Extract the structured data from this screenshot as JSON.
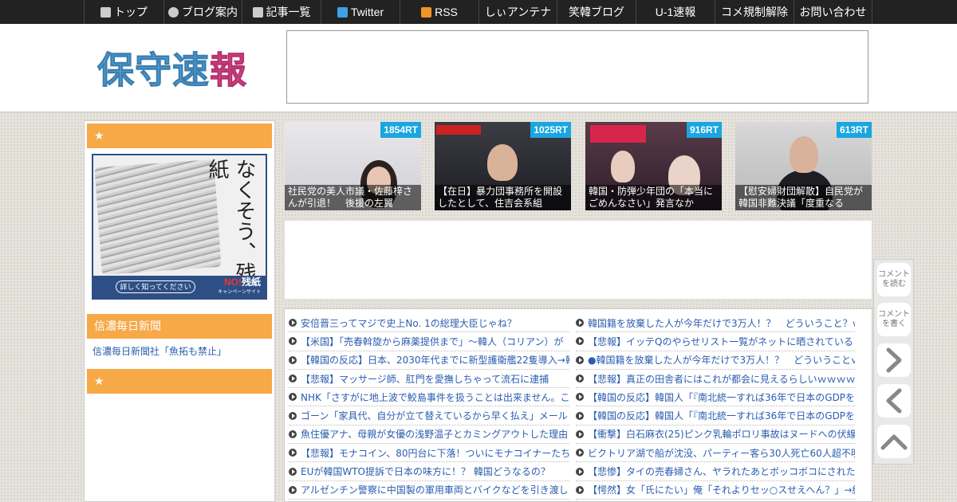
{
  "nav": {
    "items": [
      {
        "label": "トップ",
        "icon": "home-icon"
      },
      {
        "label": "ブログ案内",
        "icon": "info-icon"
      },
      {
        "label": "記事一覧",
        "icon": "list-icon"
      },
      {
        "label": "Twitter",
        "icon": "twitter-icon"
      },
      {
        "label": "RSS",
        "icon": "rss-icon"
      },
      {
        "label": "しぃアンテナ",
        "icon": ""
      },
      {
        "label": "笑韓ブログ",
        "icon": ""
      },
      {
        "label": "U-1速報",
        "icon": ""
      },
      {
        "label": "コメ規制解除",
        "icon": ""
      },
      {
        "label": "お問い合わせ",
        "icon": ""
      }
    ]
  },
  "header": {
    "logo_main": "保守速",
    "logo_accent": "報"
  },
  "sidebar": {
    "head1": "★",
    "banner": {
      "vertical_text": "なくそう、残紙",
      "more_label": "詳しく知ってください",
      "badge_no": "NO!",
      "badge_word": "残紙",
      "badge_sub": "キャンペーンサイト"
    },
    "head2": "信濃毎日新聞",
    "link": "信濃毎日新聞社「魚拓も禁止」",
    "head3": "★"
  },
  "featured": [
    {
      "rt": "1854RT",
      "caption": "社民党の美人市議・佐藤梓さんが引退！　後援の左翼"
    },
    {
      "rt": "1025RT",
      "caption": "【在日】暴力団事務所を開設したとして、住吉会系組"
    },
    {
      "rt": "916RT",
      "caption": "韓国・防弾少年団の「本当にごめんなさい」発言なか"
    },
    {
      "rt": "613RT",
      "caption": "【慰安婦財団解散】自民党が韓国非難決議「度重なる"
    }
  ],
  "list_left": [
    "安倍晋三ってマジで史上No. 1の総理大臣じゃね？",
    "【米国】「売春斡旋から麻薬提供まで」～韓人（コリアン）が",
    "【韓国の反応】日本、2030年代までに新型護衛艦22隻導入→韓",
    "【悲報】マッサージ師、肛門を愛撫しちゃって流石に逮捕",
    "NHK「さすがに地上波で鮫島事件を扱うことは出来ません。こ",
    "ゴーン「家具代、自分が立て替えているから早く払え」メール",
    "魚住優アナ、母親が女優の浅野温子とカミングアウトした理由",
    "【悲報】モナコイン、80円台に下落！ついにモナコイナーたち",
    "EUが韓国WTO提訴で日本の味方に！？ 韓国どうなるの？",
    "アルゼンチン警察に中国製の軍用車両とバイクなどを引き渡し"
  ],
  "list_right": [
    "韓国籍を放棄した人が今年だけで3万人！？　どういうこと？ｗ",
    "【悲報】イッテQのやらせリスト一覧がネットに晒されている",
    "●韓国籍を放棄した人が今年だけで3万人！？　どういうことｗ",
    "【悲報】真正の田舎者にはこれが都会に見えるらしいｗｗｗｗ",
    "【韓国の反応】韓国人「『南北統一すれば36年で日本のGDPを",
    "【韓国の反応】韓国人「『南北統一すれば36年で日本のGDPを",
    "【衝撃】白石麻衣(25)ピンク乳輪ポロリ事故はヌードへの伏線",
    "ビクトリア湖で船が沈没、パーティー客ら30人死亡60人超不明",
    "【悲惨】タイの売春婦さん、ヤラれたあとボッコボコにされた",
    "【愕然】女「氏にたい」俺「それよりセッ○スせえへん？」→結"
  ],
  "float": {
    "read_comments": "コメント\nを読む",
    "write_comment": "コメント\nを書く"
  },
  "colors": {
    "nav_bg": "#222222",
    "accent_orange": "#f7a847",
    "rt_badge": "#1aa6e0",
    "link": "#2a5db0"
  }
}
